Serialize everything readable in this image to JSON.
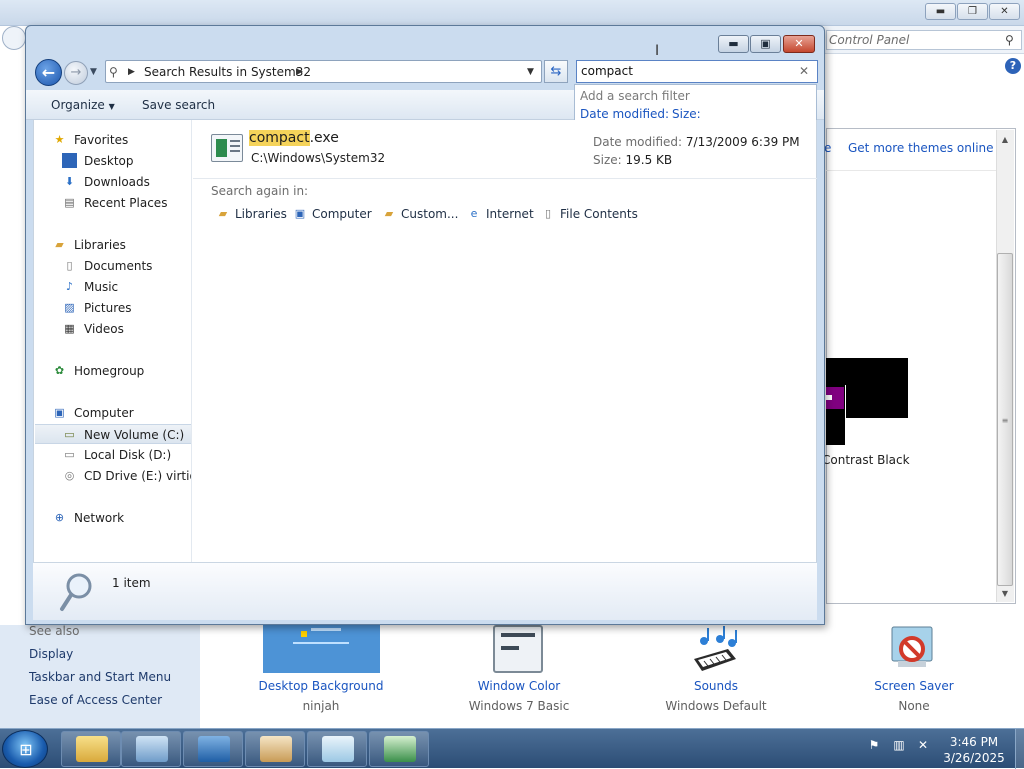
{
  "background_window": {
    "search_placeholder": "Control Panel",
    "theme_link_partial": "e",
    "theme_link": "Get more themes online",
    "theme_high_contrast_label": "Contrast Black",
    "see_also": {
      "heading": "See also",
      "links": [
        "Display",
        "Taskbar and Start Menu",
        "Ease of Access Center"
      ]
    },
    "bottom_items": [
      {
        "label": "Desktop Background",
        "value": "ninjah"
      },
      {
        "label": "Window Color",
        "value": "Windows 7 Basic"
      },
      {
        "label": "Sounds",
        "value": "Windows Default"
      },
      {
        "label": "Screen Saver",
        "value": "None"
      }
    ]
  },
  "explorer": {
    "address": "Search Results in System32",
    "search_text": "compact",
    "search_dropdown": {
      "hint": "Add a search filter",
      "filters": [
        "Date modified:",
        "Size:"
      ]
    },
    "commands": [
      "Organize",
      "Save search"
    ],
    "nav": {
      "favorites": {
        "label": "Favorites",
        "items": [
          "Desktop",
          "Downloads",
          "Recent Places"
        ]
      },
      "libraries": {
        "label": "Libraries",
        "items": [
          "Documents",
          "Music",
          "Pictures",
          "Videos"
        ]
      },
      "homegroup": "Homegroup",
      "computer": {
        "label": "Computer",
        "items": [
          "New Volume (C:)",
          "Local Disk (D:)",
          "CD Drive (E:) virtio-v"
        ]
      },
      "network": "Network"
    },
    "result": {
      "name_match": "compact",
      "name_rest": ".exe",
      "path": "C:\\Windows\\System32",
      "date_modified_label": "Date modified:",
      "date_modified": "7/13/2009 6:39 PM",
      "size_label": "Size:",
      "size": "19.5 KB"
    },
    "search_again": {
      "label": "Search again in:",
      "targets": [
        "Libraries",
        "Computer",
        "Custom...",
        "Internet",
        "File Contents"
      ]
    },
    "status": "1 item"
  },
  "taskbar": {
    "time": "3:46 PM",
    "date": "3/26/2025"
  },
  "colors": {
    "link_blue": "#1a55c0",
    "highlight": "#f5d35a",
    "taskbar": "#2c4d75"
  }
}
